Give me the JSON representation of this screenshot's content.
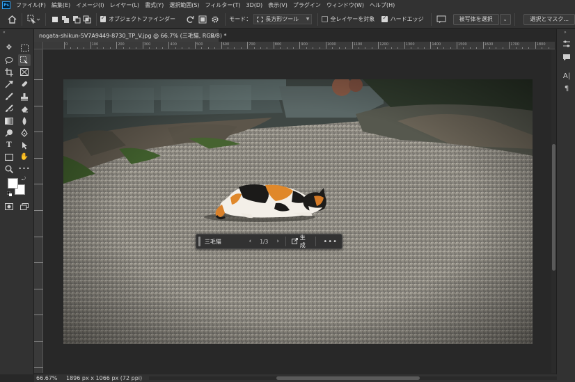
{
  "menu": {
    "logo": "Ps",
    "items": [
      "ファイル(F)",
      "編集(E)",
      "イメージ(I)",
      "レイヤー(L)",
      "書式(Y)",
      "選択範囲(S)",
      "フィルター(T)",
      "3D(D)",
      "表示(V)",
      "プラグイン",
      "ウィンドウ(W)",
      "ヘルプ(H)"
    ]
  },
  "options": {
    "object_finder_label": "オブジェクトファインダー",
    "mode_label": "モード：",
    "mode_value": "長方形ツール",
    "all_layers_label": "全レイヤーを対象",
    "hard_edge_label": "ハードエッジ",
    "select_subject_label": "被写体を選択",
    "select_mask_label": "選択とマスク..."
  },
  "document": {
    "tab_title": "nogata-shikun-5V7A9449-8730_TP_V.jpg @ 66.7% (三毛猫, RGB/8) *",
    "close_glyph": "×"
  },
  "ruler_labels": [
    "0",
    "100",
    "200",
    "300",
    "400",
    "500",
    "600",
    "700",
    "800",
    "900",
    "1000",
    "1100",
    "1200",
    "1300",
    "1400",
    "1500",
    "1600",
    "1700",
    "1800",
    "1900"
  ],
  "context_bar": {
    "input_value": "三毛猫",
    "prev_glyph": "‹",
    "count": "1/3",
    "next_glyph": "›",
    "generate_label": "生成",
    "more_glyph": "•••"
  },
  "status": {
    "zoom": "66.67%",
    "dimensions": "1896 px x 1066 px (72 ppi)",
    "arrow": "›"
  },
  "colors": {
    "foreground": "#ffffff",
    "background": "#ffffff",
    "accent": "#31a8ff"
  }
}
